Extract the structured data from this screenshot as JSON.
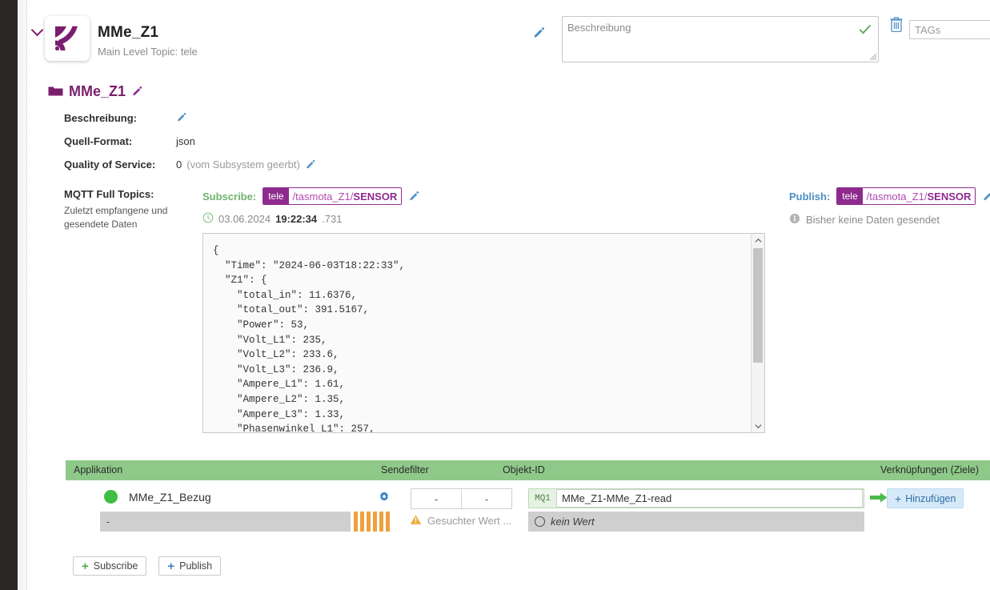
{
  "device": {
    "title": "MMe_Z1",
    "subtitle": "Main Level Topic: tele",
    "description_placeholder": "Beschreibung",
    "description_value": "",
    "tags_placeholder": "TAGs",
    "tags_value": ""
  },
  "topic": {
    "name": "MMe_Z1",
    "fields": [
      {
        "label": "Beschreibung:",
        "value": "",
        "muted": "",
        "has_pencil": true
      },
      {
        "label": "Quell-Format:",
        "value": "json",
        "muted": "",
        "has_pencil": false
      },
      {
        "label": "Quality of Service:",
        "value": "0",
        "muted": "(vom Subsystem geerbt)",
        "has_pencil": true
      }
    ],
    "mqtt_label": "MQTT Full Topics:",
    "mqtt_sublabel": "Zuletzt empfangene und gesendete Daten",
    "subscribe": {
      "label": "Subscribe:",
      "prefix": "tele",
      "path": "/tasmota_Z1/",
      "leaf": "SENSOR",
      "date": "03.06.2024",
      "time": "19:22:34",
      "ms": ".731"
    },
    "publish": {
      "label": "Publish:",
      "prefix": "tele",
      "path": "/tasmota_Z1/",
      "leaf": "SENSOR",
      "status": "Bisher keine Daten gesendet"
    },
    "payload": "{\n  \"Time\": \"2024-06-03T18:22:33\",\n  \"Z1\": {\n    \"total_in\": 11.6376,\n    \"total_out\": 391.5167,\n    \"Power\": 53,\n    \"Volt_L1\": 235,\n    \"Volt_L2\": 233.6,\n    \"Volt_L3\": 236.9,\n    \"Ampere_L1\": 1.61,\n    \"Ampere_L2\": 1.35,\n    \"Ampere_L3\": 1.33,\n    \"Phasenwinkel L1\": 257,"
  },
  "table": {
    "columns": {
      "application": "Applikation",
      "sendfilter": "Sendefilter",
      "objectid": "Objekt-ID",
      "links": "Verknüpfungen (Ziele)"
    },
    "row": {
      "app_name": "MMe_Z1_Bezug",
      "value_text": "-",
      "sendfilter_left": "-",
      "sendfilter_right": "-",
      "sendfilter_warning": "Gesuchter Wert ...",
      "objectid_badge": "MQ1",
      "objectid_value": "MMe_Z1-MMe_Z1-read",
      "objectid_state": "kein Wert",
      "add_label": "Hinzufügen",
      "add_plus": "+"
    }
  },
  "footer": {
    "subscribe_label": "Subscribe",
    "publish_label": "Publish",
    "plus": "+"
  },
  "colors": {
    "brand_purple": "#8e2a8e",
    "header_green": "#8fc98a",
    "accent_blue": "#3e87c8",
    "status_green": "#3fbf3f",
    "warn_orange": "#eda13e"
  }
}
